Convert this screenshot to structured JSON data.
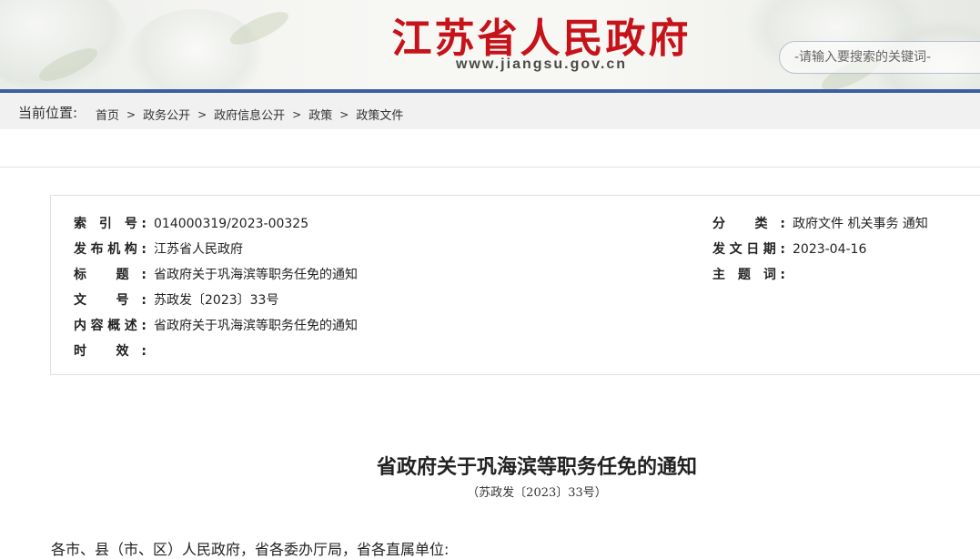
{
  "header": {
    "site_title": "江苏省人民政府",
    "site_url": "www.jiangsu.gov.cn",
    "search_placeholder": "-请输入要搜索的关键词-"
  },
  "breadcrumb": {
    "label": "当前位置:",
    "items": [
      "首页",
      "政务公开",
      "政府信息公开",
      "政策",
      "政策文件"
    ],
    "separator": ">"
  },
  "info": {
    "index_label": "索 引 号:",
    "index_value": "014000319/2023-00325",
    "issuer_label": "发布机构:",
    "issuer_value": "江苏省人民政府",
    "title_label": "标 题:",
    "title_value": "省政府关于巩海滨等职务任免的通知",
    "docno_label": "文 号:",
    "docno_value": "苏政发〔2023〕33号",
    "summary_label": "内容概述:",
    "summary_value": "省政府关于巩海滨等职务任免的通知",
    "validity_label": "时 效:",
    "validity_value": "",
    "category_label": "分 类:",
    "category_value": "政府文件 机关事务 通知",
    "date_label": "发文日期:",
    "date_value": "2023-04-16",
    "keywords_label": "主 题 词:",
    "keywords_value": ""
  },
  "article": {
    "title": "省政府关于巩海滨等职务任免的通知",
    "doc_number": "（苏政发〔2023〕33号）",
    "salutation": "各市、县（市、区）人民政府，省各委办厅局，省各直属单位:"
  },
  "colors": {
    "title_red": "#c6131a",
    "nav_blue": "#3b5fa0",
    "crumb_bg": "#f1f1f1"
  }
}
